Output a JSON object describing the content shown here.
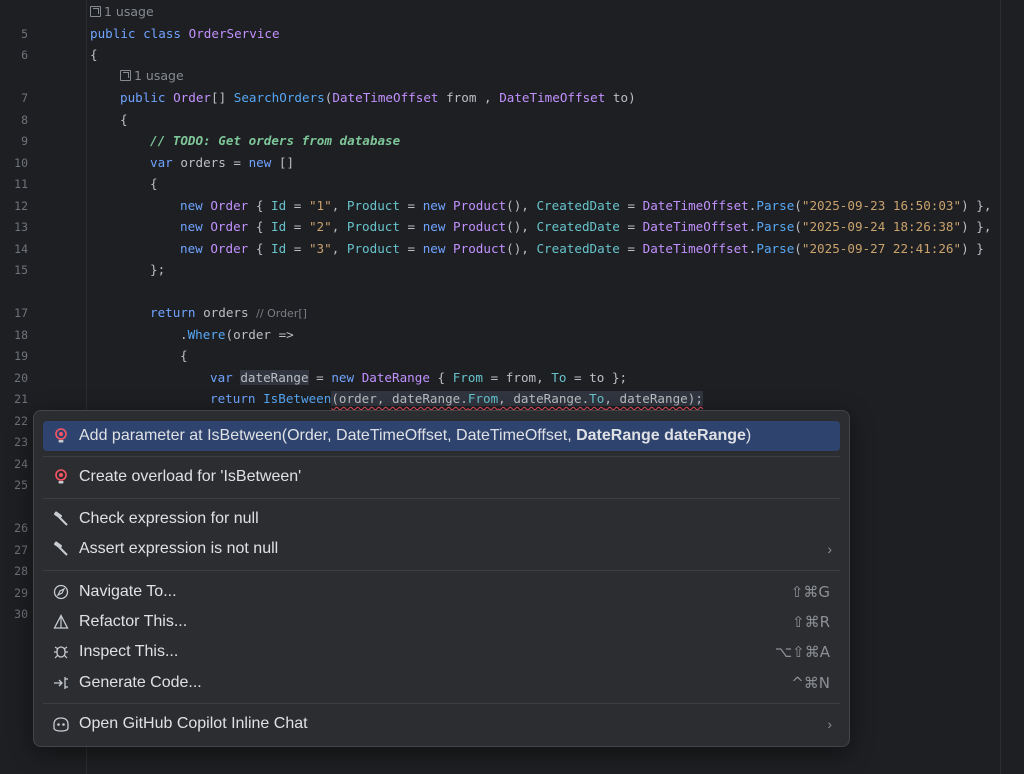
{
  "editor": {
    "usage_hint_class": "1 usage",
    "usage_hint_method": "1 usage",
    "line_numbers": [
      "5",
      "6",
      "7",
      "8",
      "9",
      "10",
      "11",
      "12",
      "13",
      "14",
      "15",
      "17",
      "18",
      "19",
      "20",
      "21",
      "22",
      "23",
      "24",
      "25",
      "26",
      "27",
      "28",
      "29",
      "30"
    ],
    "code": {
      "l5": [
        "public",
        "class",
        "OrderService"
      ],
      "l6": "{",
      "l7": [
        "public",
        "Order",
        "[] ",
        "SearchOrders",
        "(",
        "DateTimeOffset",
        " from , ",
        "DateTimeOffset",
        " to)"
      ],
      "l8": "{",
      "l9": "// TODO: Get orders from database",
      "l10": [
        "var",
        " orders = ",
        "new",
        " []"
      ],
      "l11": "{",
      "l12": [
        "new",
        "Order",
        "Id",
        "\"1\"",
        "Product",
        "new",
        "Product",
        "CreatedDate",
        "DateTimeOffset",
        "Parse",
        "\"2025-09-23 16:50:03\"",
        ") },"
      ],
      "l13": [
        "new",
        "Order",
        "Id",
        "\"2\"",
        "Product",
        "new",
        "Product",
        "CreatedDate",
        "DateTimeOffset",
        "Parse",
        "\"2025-09-24 18:26:38\"",
        ") },"
      ],
      "l14": [
        "new",
        "Order",
        "Id",
        "\"3\"",
        "Product",
        "new",
        "Product",
        "CreatedDate",
        "DateTimeOffset",
        "Parse",
        "\"2025-09-27 22:41:26\"",
        ") }"
      ],
      "l15": "};",
      "l17": [
        "return",
        " orders"
      ],
      "l17_inlay": "// Order[]",
      "l18": [
        ".",
        "Where",
        "(order =>"
      ],
      "l19": "{",
      "l20": [
        "var",
        "dateRange",
        " = ",
        "new",
        "DateRange",
        " { ",
        "From",
        " = from, ",
        "To",
        " = to };"
      ],
      "l21": [
        "return",
        "IsBetween",
        "(order, dateRange.",
        "From",
        ", dateRange.",
        "To",
        ", dateRange);"
      ]
    }
  },
  "popup": {
    "items": [
      {
        "label": "Add parameter at IsBetween(Order, DateTimeOffset, DateTimeOffset, ",
        "label_bold": "DateRange dateRange",
        "label_end": ")",
        "icon": "bulb-icon",
        "active": true
      },
      {
        "label": "Create overload for 'IsBetween'",
        "icon": "bulb-icon"
      },
      {
        "label": "Check expression for null",
        "icon": "hammer-icon"
      },
      {
        "label": "Assert expression is not null",
        "icon": "hammer-icon",
        "chevron": "›"
      },
      {
        "label": "Navigate To...",
        "icon": "compass-icon",
        "shortcut": "⇧⌘G"
      },
      {
        "label": "Refactor This...",
        "icon": "refactor-icon",
        "shortcut": "⇧⌘R"
      },
      {
        "label": "Inspect This...",
        "icon": "inspect-icon",
        "shortcut": "⌥⇧⌘A"
      },
      {
        "label": "Generate Code...",
        "icon": "generate-icon",
        "shortcut": "^⌘N"
      },
      {
        "label": "Open GitHub Copilot Inline Chat",
        "icon": "copilot-icon",
        "chevron": "›"
      }
    ]
  },
  "colors": {
    "background": "#1e1f22",
    "popup_background": "#2b2d30",
    "active_row": "#2e436e",
    "keyword": "#6fa3ff",
    "type": "#c191ff",
    "string": "#c9a26d",
    "comment": "#7ec699"
  }
}
